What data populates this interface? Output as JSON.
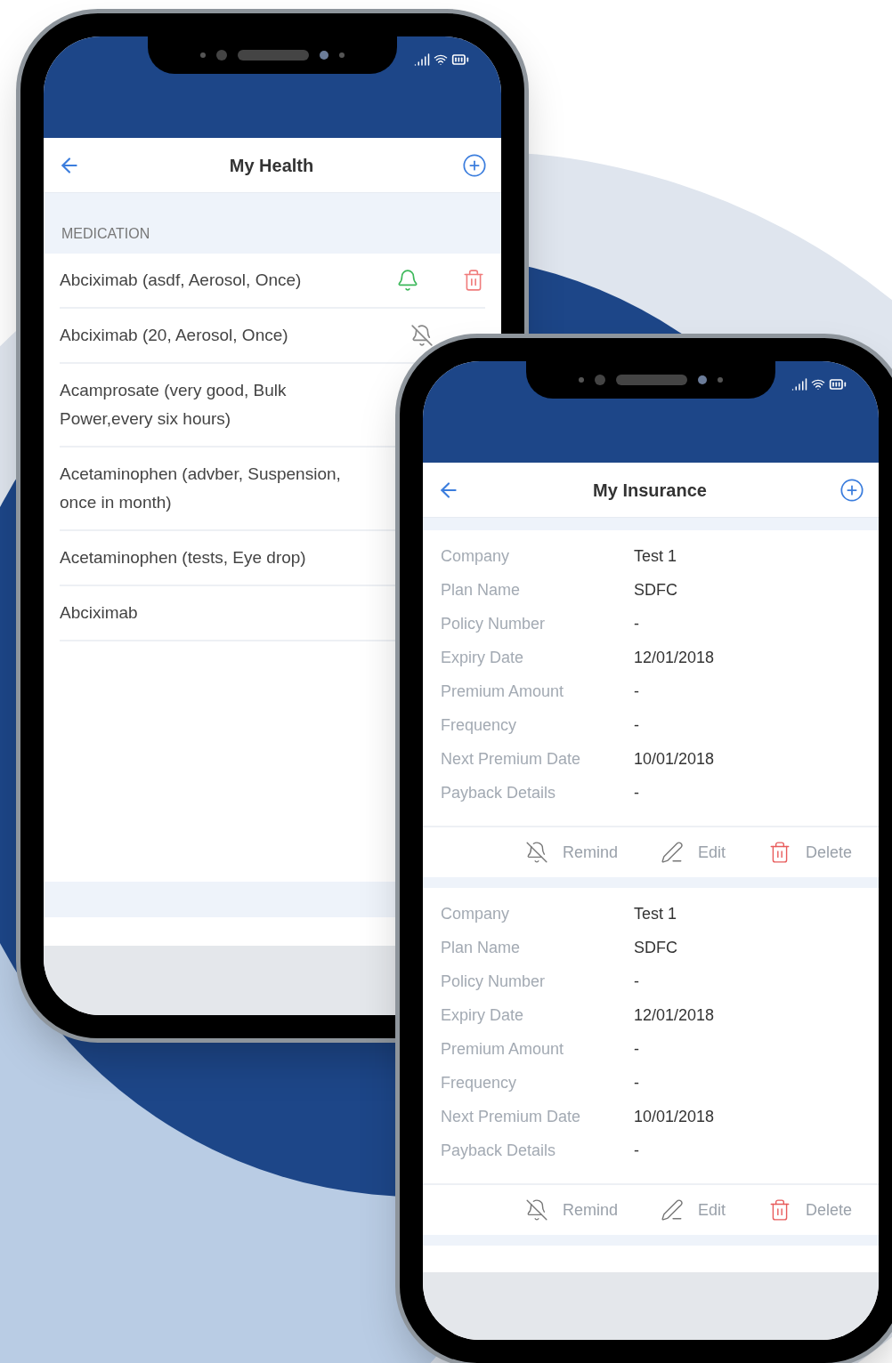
{
  "health": {
    "title": "My Health",
    "section": "MEDICATION",
    "medications": [
      {
        "name": "Abciximab (asdf, Aerosol, Once)",
        "icons": [
          {
            "kind": "bell"
          },
          {
            "kind": "trash"
          }
        ]
      },
      {
        "name": "Abciximab (20, Aerosol, Once)",
        "icons": [
          {
            "kind": "bell-off"
          }
        ]
      },
      {
        "name": "Acamprosate (very good, Bulk Power,every six hours)"
      },
      {
        "name": "Acetaminophen (advber, Suspension, once in month)"
      },
      {
        "name": "Acetaminophen (tests, Eye drop)"
      },
      {
        "name": "Abciximab"
      }
    ]
  },
  "insurance": {
    "title": "My Insurance",
    "policies": [
      {
        "fields": [
          {
            "label": "Company",
            "value": "Test 1"
          },
          {
            "label": "Plan Name",
            "value": "SDFC"
          },
          {
            "label": "Policy Number",
            "value": "-"
          },
          {
            "label": "Expiry Date",
            "value": "12/01/2018"
          },
          {
            "label": "Premium Amount",
            "value": "-"
          },
          {
            "label": "Frequency",
            "value": "-"
          },
          {
            "label": "Next Premium Date",
            "value": "10/01/2018"
          },
          {
            "label": "Payback Details",
            "value": "-"
          }
        ],
        "actions": [
          {
            "kind": "remind",
            "label": "Remind"
          },
          {
            "kind": "edit",
            "label": "Edit"
          },
          {
            "kind": "delete",
            "label": "Delete"
          }
        ]
      },
      {
        "fields": [
          {
            "label": "Company",
            "value": "Test 1"
          },
          {
            "label": "Plan Name",
            "value": "SDFC"
          },
          {
            "label": "Policy Number",
            "value": "-"
          },
          {
            "label": "Expiry Date",
            "value": "12/01/2018"
          },
          {
            "label": "Premium Amount",
            "value": "-"
          },
          {
            "label": "Frequency",
            "value": "-"
          },
          {
            "label": "Next Premium Date",
            "value": "10/01/2018"
          },
          {
            "label": "Payback Details",
            "value": "-"
          }
        ],
        "actions": [
          {
            "kind": "remind",
            "label": "Remind"
          },
          {
            "kind": "edit",
            "label": "Edit"
          },
          {
            "kind": "delete",
            "label": "Delete"
          }
        ]
      }
    ]
  }
}
